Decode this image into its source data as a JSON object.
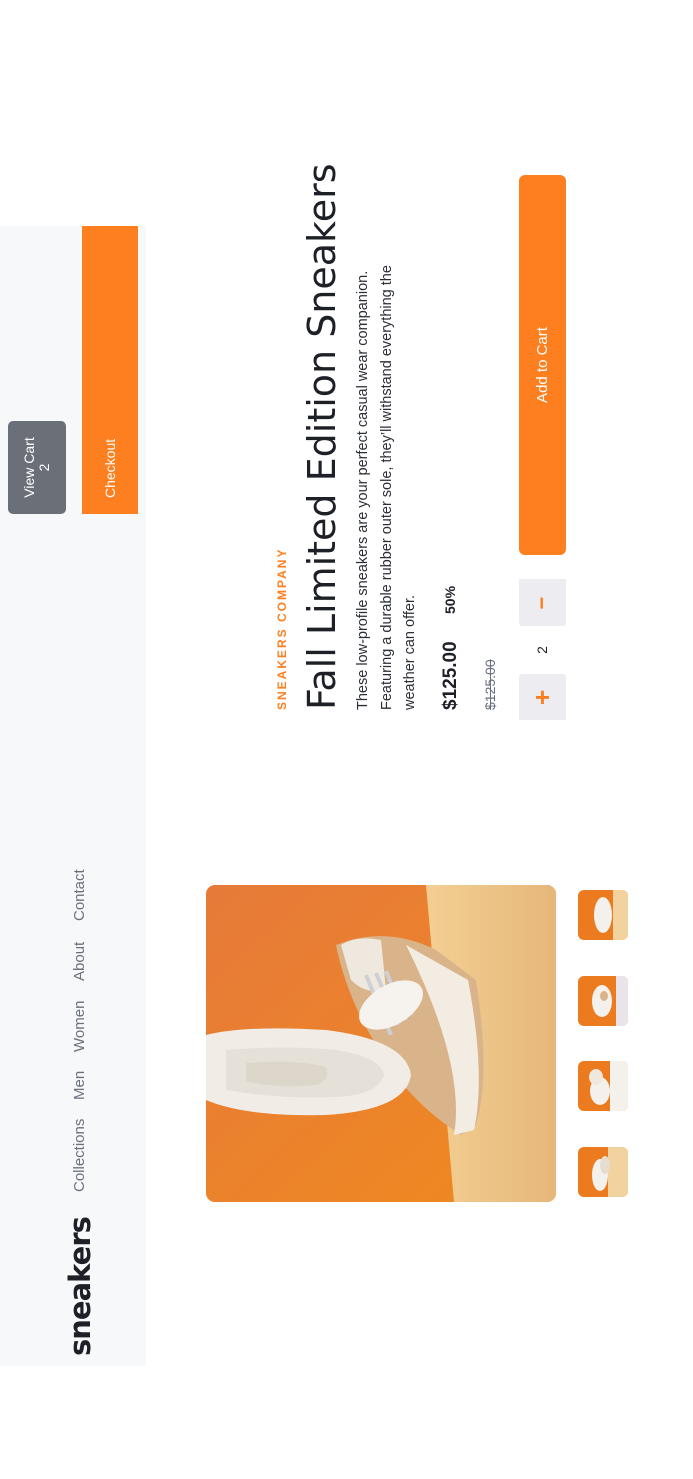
{
  "brand": {
    "logo_text": "sneakers"
  },
  "nav": {
    "items": [
      "Collections",
      "Men",
      "Women",
      "About",
      "Contact"
    ]
  },
  "cart": {
    "view_cart_label": "View Cart",
    "count": "2",
    "checkout_label": "Checkout"
  },
  "product": {
    "company": "SNEAKERS COMPANY",
    "title": "Fall Limited Edition Sneakers",
    "description": "These low-profile sneakers are your perfect casual wear companion. Featuring a durable rubber outer sole, they’ll withstand everything the weather can offer.",
    "price": "$125.00",
    "discount": "50%",
    "original_price": "$125.00",
    "quantity": "2",
    "minus_symbol": "−",
    "plus_symbol": "+",
    "add_to_cart_label": "Add to Cart"
  },
  "colors": {
    "accent": "#fd7f1f",
    "dark": "#1d2026",
    "muted": "#69707d",
    "panel": "#f7f8fa",
    "view_cart_bg": "#6b7078"
  }
}
